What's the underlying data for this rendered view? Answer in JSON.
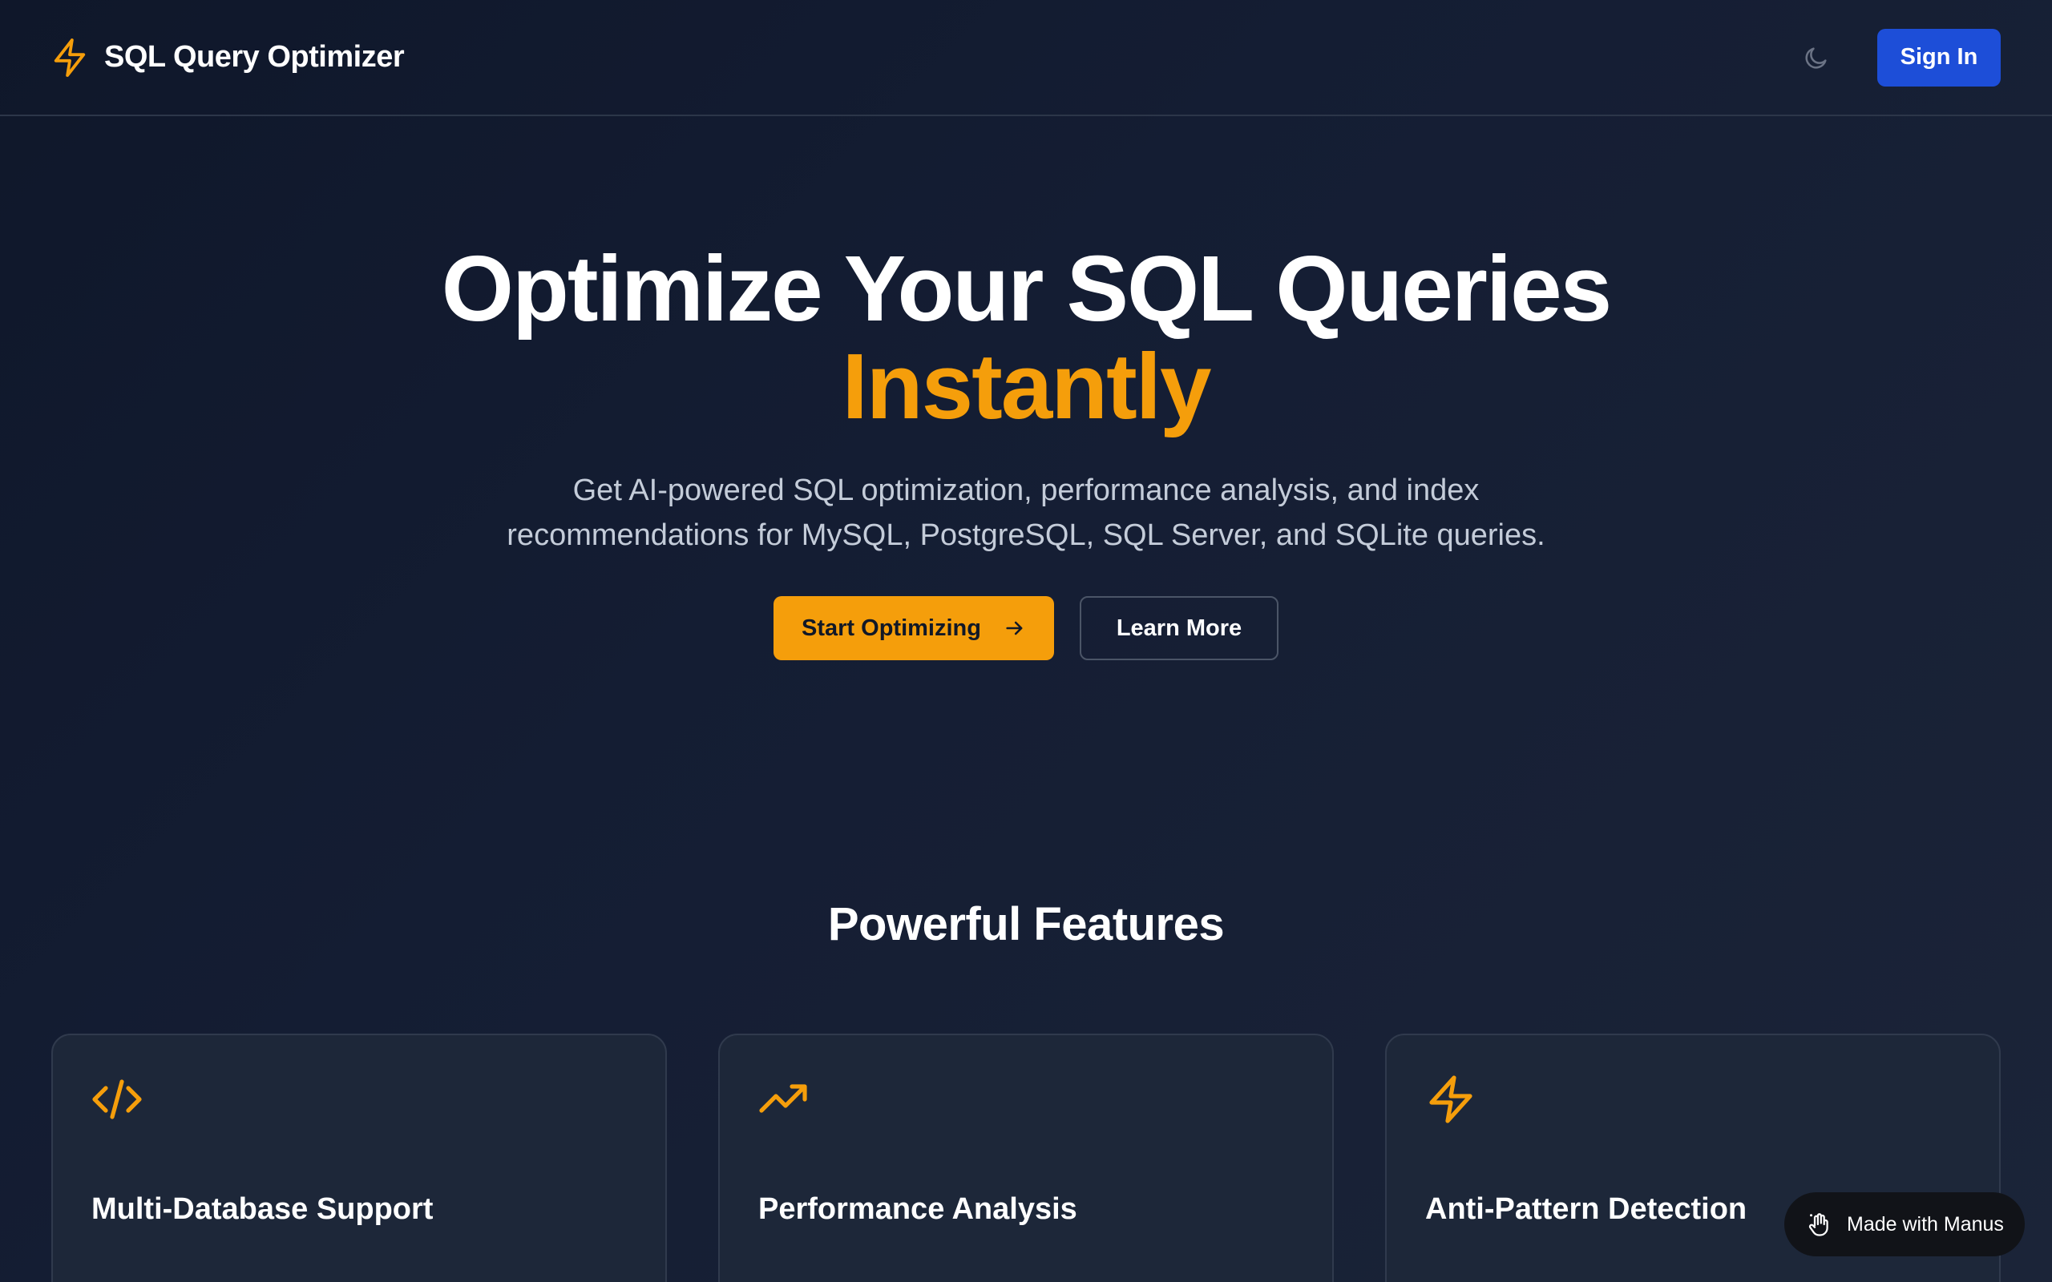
{
  "header": {
    "brand_icon": "lightning-bolt-icon",
    "brand_title": "SQL Query Optimizer",
    "theme_icon": "moon-icon",
    "sign_in_label": "Sign In"
  },
  "hero": {
    "title_line1": "Optimize Your SQL Queries",
    "title_line2": "Instantly",
    "subtitle": "Get AI-powered SQL optimization, performance analysis, and index recommendations for MySQL, PostgreSQL, SQL Server, and SQLite queries.",
    "primary_cta": "Start Optimizing",
    "primary_cta_icon": "arrow-right-icon",
    "secondary_cta": "Learn More"
  },
  "features": {
    "title": "Powerful Features",
    "cards": [
      {
        "icon": "code-icon",
        "title": "Multi-Database Support"
      },
      {
        "icon": "trending-up-icon",
        "title": "Performance Analysis"
      },
      {
        "icon": "lightning-bolt-icon",
        "title": "Anti-Pattern Detection"
      }
    ]
  },
  "badge": {
    "icon": "hand-icon",
    "label": "Made with Manus"
  },
  "colors": {
    "accent": "#f59e0b",
    "primary_button": "#1d4ed8",
    "background": "#131c30",
    "card": "#1d2739"
  }
}
